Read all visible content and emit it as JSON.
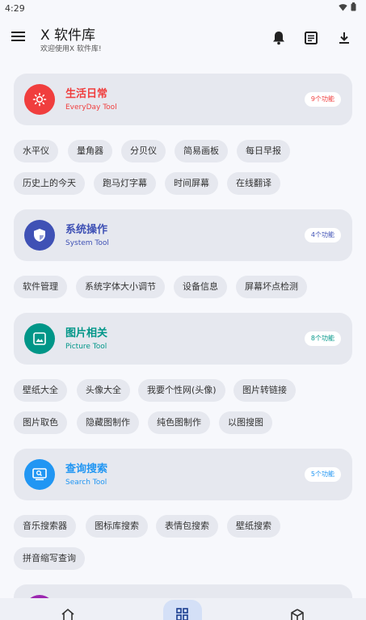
{
  "status": {
    "time": "4:29"
  },
  "header": {
    "title": "X 软件库",
    "subtitle": "欢迎使用X 软件库!",
    "menu_icon": "menu-icon",
    "actions": [
      "bell-icon",
      "notes-icon",
      "download-icon"
    ]
  },
  "sections": [
    {
      "title": "生活日常",
      "subtitle": "EveryDay Tool",
      "badge": "9个功能",
      "icon": "sun-icon",
      "color": "#f03e3e",
      "chips": [
        [
          "水平仪",
          "量角器",
          "分贝仪",
          "简易画板",
          "每日早报"
        ],
        [
          "历史上的今天",
          "跑马灯字幕",
          "时间屏幕",
          "在线翻译"
        ]
      ]
    },
    {
      "title": "系统操作",
      "subtitle": "System Tool",
      "badge": "4个功能",
      "icon": "shield-icon",
      "color": "#3f51b5",
      "chips": [
        [
          "软件管理",
          "系统字体大小调节",
          "设备信息",
          "屏幕坏点检测"
        ]
      ]
    },
    {
      "title": "图片相关",
      "subtitle": "Picture Tool",
      "badge": "8个功能",
      "icon": "image-icon",
      "color": "#009688",
      "chips": [
        [
          "壁纸大全",
          "头像大全",
          "我要个性网(头像)",
          "图片转链接"
        ],
        [
          "图片取色",
          "隐藏图制作",
          "纯色图制作",
          "以图搜图"
        ]
      ]
    },
    {
      "title": "查询搜索",
      "subtitle": "Search Tool",
      "badge": "5个功能",
      "icon": "search-screen-icon",
      "color": "#2196f3",
      "chips": [
        [
          "音乐搜索器",
          "图标库搜索",
          "表情包搜索",
          "壁纸搜索"
        ],
        [
          "拼音缩写查询"
        ]
      ]
    }
  ],
  "partial_section": {
    "color": "#9c27b0"
  },
  "bottom_nav": [
    {
      "icon": "home-icon",
      "active": false
    },
    {
      "icon": "apps-icon",
      "active": true
    },
    {
      "icon": "box-icon",
      "active": false
    }
  ],
  "colors": {
    "background": "#f7f8fc",
    "card": "#e6e8ef",
    "nav_active": "#d4e0f7"
  }
}
